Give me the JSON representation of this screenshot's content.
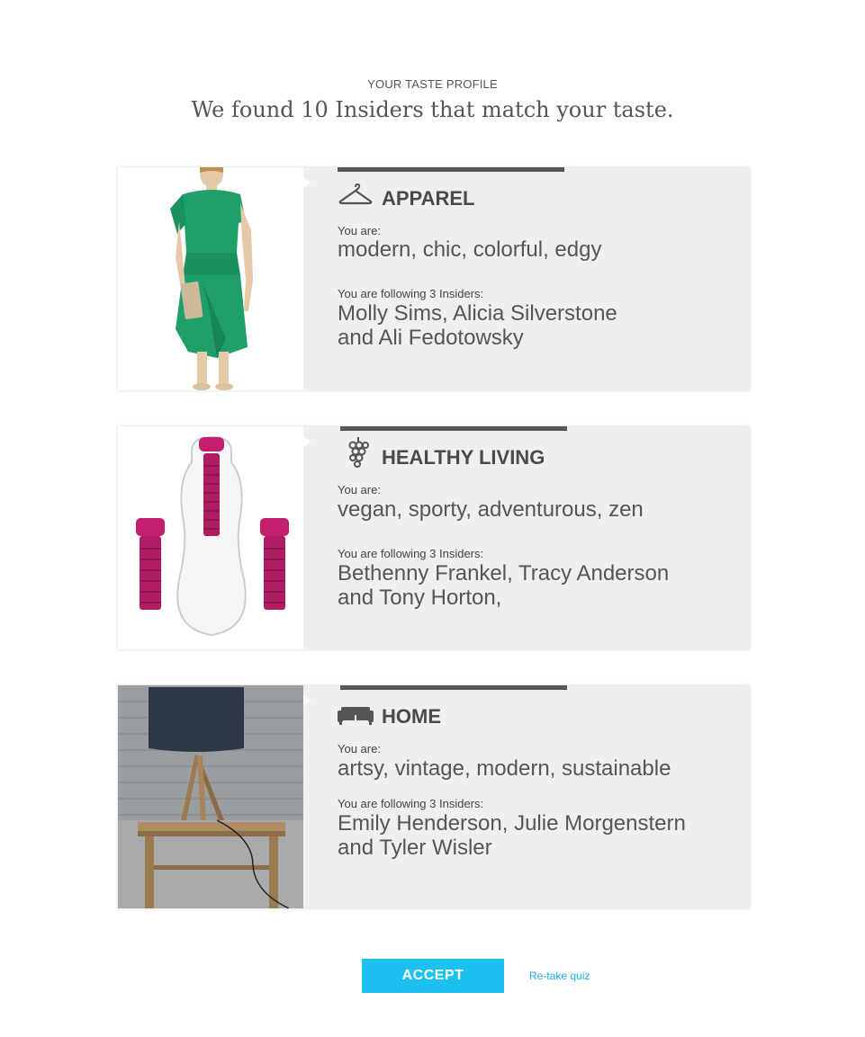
{
  "header": {
    "eyebrow": "YOUR TASTE PROFILE",
    "headline": "We found 10 Insiders that match your taste."
  },
  "categories": [
    {
      "title": "APPAREL",
      "icon": "hanger-icon",
      "you_are_label": "You are:",
      "traits": "modern, chic, colorful, edgy",
      "following_label": "You are following 3 Insiders:",
      "insiders_line1": "Molly Sims, Alicia Silverstone",
      "insiders_line2": "and Ali Fedotowsky",
      "image": "green-dress-photo"
    },
    {
      "title": "HEALTHY LIVING",
      "icon": "grapes-icon",
      "you_are_label": "You are:",
      "traits": "vegan, sporty, adventurous, zen",
      "following_label": "You are following 3 Insiders:",
      "insiders_line1": "Bethenny Frankel, Tracy Anderson",
      "insiders_line2": "and Tony Horton,",
      "image": "water-bottle-photo"
    },
    {
      "title": "HOME",
      "icon": "sofa-icon",
      "you_are_label": "You are:",
      "traits": "artsy, vintage, modern, sustainable",
      "following_label": "You are following 3 Insiders:",
      "insiders_line1": "Emily Henderson, Julie Morgenstern",
      "insiders_line2": "and Tyler Wisler",
      "image": "table-lamp-photo"
    }
  ],
  "actions": {
    "accept_label": "ACCEPT",
    "retake_label": "Re-take quiz"
  },
  "colors": {
    "accent": "#1cc1f0",
    "link": "#1aaee3",
    "card_bg": "#efefef",
    "dress": "#1fa06a",
    "bottle_accent": "#c2206f"
  }
}
